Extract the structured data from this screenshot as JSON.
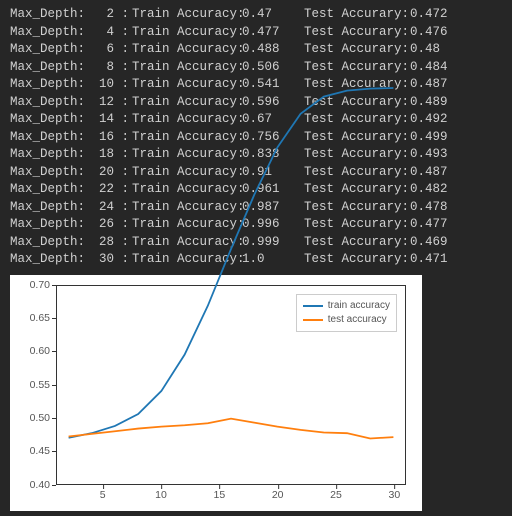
{
  "labels": {
    "depth": "Max_Depth:",
    "sep": ":",
    "train": "Train Accuracy:",
    "test": "Test Accurary:"
  },
  "rows": [
    {
      "depth": 2,
      "train": "0.47",
      "test": "0.472"
    },
    {
      "depth": 4,
      "train": "0.477",
      "test": "0.476"
    },
    {
      "depth": 6,
      "train": "0.488",
      "test": "0.48"
    },
    {
      "depth": 8,
      "train": "0.506",
      "test": "0.484"
    },
    {
      "depth": 10,
      "train": "0.541",
      "test": "0.487"
    },
    {
      "depth": 12,
      "train": "0.596",
      "test": "0.489"
    },
    {
      "depth": 14,
      "train": "0.67",
      "test": "0.492"
    },
    {
      "depth": 16,
      "train": "0.756",
      "test": "0.499"
    },
    {
      "depth": 18,
      "train": "0.838",
      "test": "0.493"
    },
    {
      "depth": 20,
      "train": "0.91",
      "test": "0.487"
    },
    {
      "depth": 22,
      "train": "0.961",
      "test": "0.482"
    },
    {
      "depth": 24,
      "train": "0.987",
      "test": "0.478"
    },
    {
      "depth": 26,
      "train": "0.996",
      "test": "0.477"
    },
    {
      "depth": 28,
      "train": "0.999",
      "test": "0.469"
    },
    {
      "depth": 30,
      "train": "1.0",
      "test": "0.471"
    }
  ],
  "chart_data": {
    "type": "line",
    "x": [
      2,
      4,
      6,
      8,
      10,
      12,
      14,
      16,
      18,
      20,
      22,
      24,
      26,
      28,
      30
    ],
    "series": [
      {
        "name": "train accuracy",
        "color": "#1f77b4",
        "values": [
          0.47,
          0.477,
          0.488,
          0.506,
          0.541,
          0.596,
          0.67,
          0.756,
          0.838,
          0.91,
          0.961,
          0.987,
          0.996,
          0.999,
          1.0
        ]
      },
      {
        "name": "test accuracy",
        "color": "#ff7f0e",
        "values": [
          0.472,
          0.476,
          0.48,
          0.484,
          0.487,
          0.489,
          0.492,
          0.499,
          0.493,
          0.487,
          0.482,
          0.478,
          0.477,
          0.469,
          0.471
        ]
      }
    ],
    "xlim": [
      1,
      31
    ],
    "ylim": [
      0.4,
      0.7
    ],
    "yticks": [
      0.4,
      0.45,
      0.5,
      0.55,
      0.6,
      0.65,
      0.7
    ],
    "ytick_labels": [
      "0.40",
      "0.45",
      "0.50",
      "0.55",
      "0.60",
      "0.65",
      "0.70"
    ],
    "xticks": [
      5,
      10,
      15,
      20,
      25,
      30
    ],
    "xtick_labels": [
      "5",
      "10",
      "15",
      "20",
      "25",
      "30"
    ],
    "legend_position": "upper right"
  }
}
